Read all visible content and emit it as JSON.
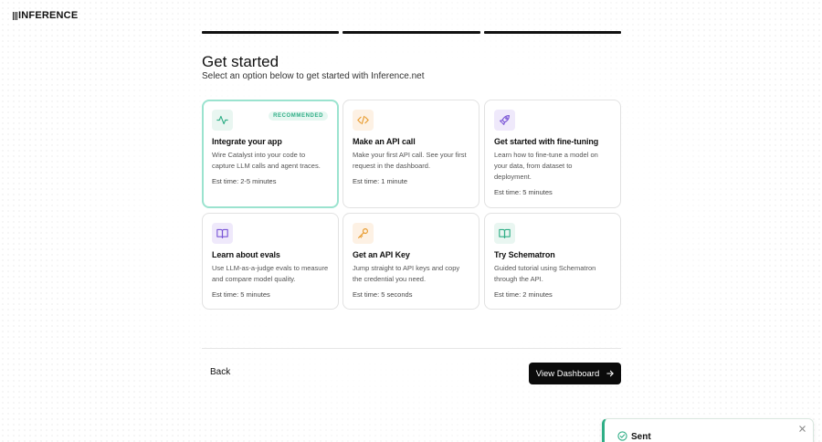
{
  "brand": {
    "name": "INFERENCE"
  },
  "progress": {
    "total_steps": 3,
    "completed_steps": 3
  },
  "header": {
    "title": "Get started",
    "subtitle": "Select an option below to get started with Inference.net"
  },
  "cards": [
    {
      "icon": "activity-icon",
      "badge": "RECOMMENDED",
      "title": "Integrate your app",
      "desc": "Wire Catalyst into your code to capture LLM calls and agent traces.",
      "est": "Est time: 2-5 minutes"
    },
    {
      "icon": "code-icon",
      "title": "Make an API call",
      "desc": "Make your first API call. See your first request in the dashboard.",
      "est": "Est time: 1 minute"
    },
    {
      "icon": "rocket-icon",
      "title": "Get started with fine-tuning",
      "desc": "Learn how to fine-tune a model on your data, from dataset to deployment.",
      "est": "Est time: 5 minutes"
    },
    {
      "icon": "book-icon",
      "title": "Learn about evals",
      "desc": "Use LLM-as-a-judge evals to measure and compare model quality.",
      "est": "Est time: 5 minutes"
    },
    {
      "icon": "key-icon",
      "title": "Get an API Key",
      "desc": "Jump straight to API keys and copy the credential you need.",
      "est": "Est time: 5 seconds"
    },
    {
      "icon": "book-icon",
      "title": "Try Schematron",
      "desc": "Guided tutorial using Schematron through the API.",
      "est": "Est time: 2 minutes"
    }
  ],
  "footer": {
    "back_label": "Back",
    "view_dashboard_label": "View Dashboard"
  },
  "toast": {
    "text": "Sent",
    "status_color": "#2fae86"
  },
  "colors": {
    "accent_green": "#2fae86",
    "orange": "#e89a2c",
    "purple": "#7b57d6",
    "selected_border": "#9be3cf"
  }
}
